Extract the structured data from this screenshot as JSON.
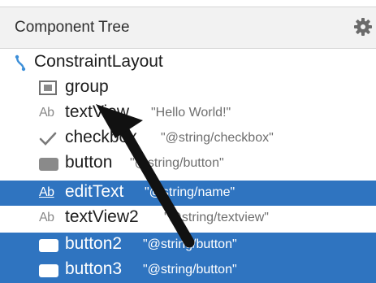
{
  "panel": {
    "title": "Component Tree",
    "settings_icon": "gear-icon"
  },
  "tree": {
    "root": {
      "label": "ConstraintLayout",
      "icon": "constraint-layout-icon"
    },
    "items": [
      {
        "name": "group",
        "value": "",
        "icon": "group-icon",
        "selected": false
      },
      {
        "name": "textView",
        "value": "\"Hello World!\"",
        "icon": "textview-icon",
        "selected": false
      },
      {
        "name": "checkbox",
        "value": "\"@string/checkbox\"",
        "icon": "checkbox-icon",
        "selected": false
      },
      {
        "name": "button",
        "value": "\"@string/button\"",
        "icon": "button-icon",
        "selected": false
      },
      {
        "name": "editText",
        "value": "\"@string/name\"",
        "icon": "edittext-icon",
        "selected": true
      },
      {
        "name": "textView2",
        "value": "\"@string/textview\"",
        "icon": "textview-icon",
        "selected": false
      },
      {
        "name": "button2",
        "value": "\"@string/button\"",
        "icon": "button-icon",
        "selected": true
      },
      {
        "name": "button3",
        "value": "\"@string/button\"",
        "icon": "button-icon",
        "selected": true
      }
    ],
    "icon_text": "Ab"
  },
  "colors": {
    "selection": "#2f74c0",
    "header_bg": "#f2f2f2",
    "arrow": "#111111"
  }
}
